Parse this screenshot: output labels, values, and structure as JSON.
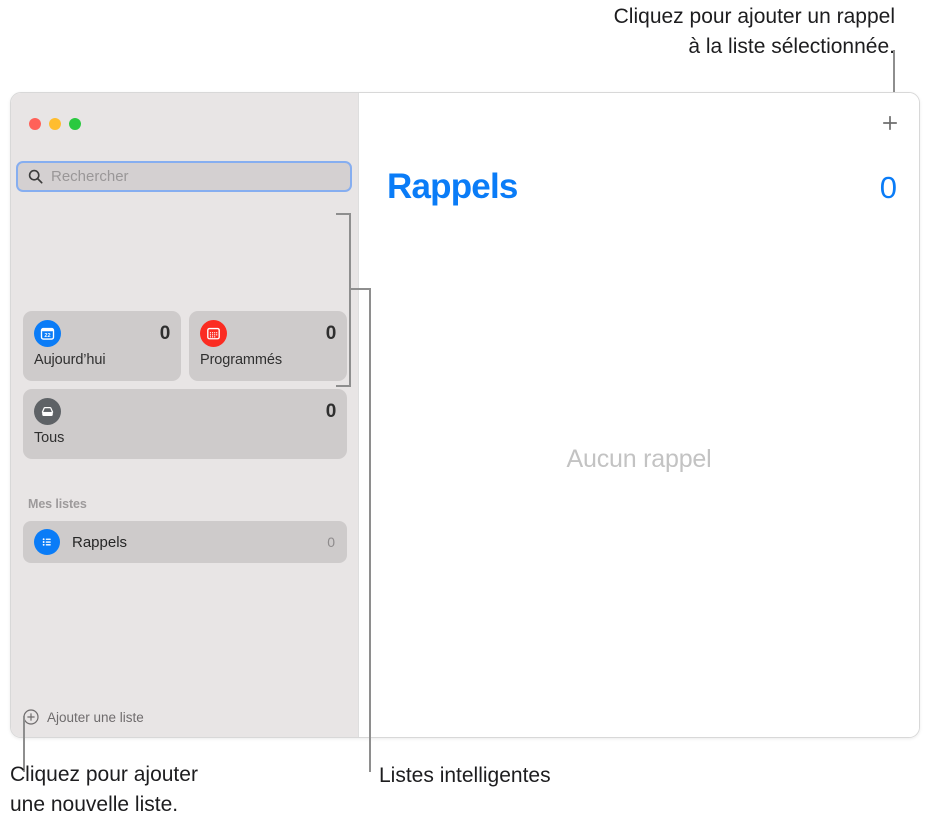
{
  "annotations": {
    "top_right": "Cliquez pour ajouter un rappel\nà la liste sélectionnée.",
    "bottom_left": "Cliquez pour ajouter\nune nouvelle liste.",
    "bottom_middle": "Listes intelligentes"
  },
  "window": {
    "traffic_lights": {
      "close": "close-button",
      "minimize": "minimize-button",
      "maximize": "maximize-button"
    }
  },
  "sidebar": {
    "search": {
      "placeholder": "Rechercher",
      "value": "",
      "icon": "search-icon"
    },
    "smart_lists": [
      {
        "label": "Aujourd’hui",
        "count": "0",
        "icon": "calendar-day-icon",
        "color": "#0a7cf7",
        "span": "half"
      },
      {
        "label": "Programmés",
        "count": "0",
        "icon": "calendar-month-icon",
        "color": "#fb2c22",
        "span": "half"
      },
      {
        "label": "Tous",
        "count": "0",
        "icon": "inbox-tray-icon",
        "color": "#5e6266",
        "span": "full"
      }
    ],
    "my_lists": {
      "header": "Mes listes",
      "items": [
        {
          "label": "Rappels",
          "count": "0",
          "icon": "bulleted-list-icon",
          "color": "#0a7cf7"
        }
      ]
    },
    "add_list": {
      "label": "Ajouter une liste",
      "icon": "plus-circle-icon"
    }
  },
  "main": {
    "title": "Rappels",
    "count": "0",
    "empty_state": "Aucun rappel",
    "add_reminder": {
      "label": "+",
      "icon": "plus-icon"
    }
  },
  "colors": {
    "accent": "#0a7cf7",
    "sidebar_bg": "#e8e5e5",
    "card_bg": "#cecbcb",
    "search_focus_ring": "#86aef0"
  }
}
